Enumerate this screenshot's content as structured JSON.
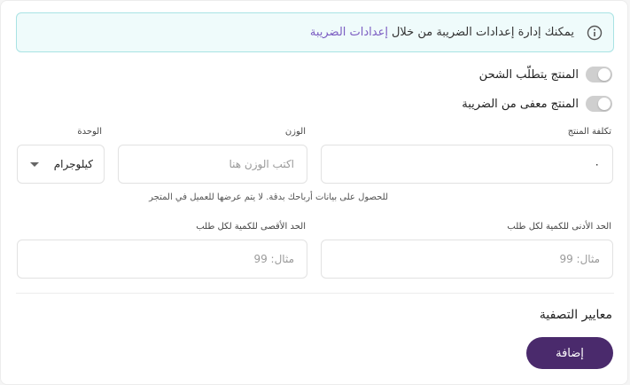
{
  "notice": {
    "text": "يمكنك إدارة إعدادات الضريبة من خلال",
    "link": "إعدادات الضريبة"
  },
  "toggles": {
    "shipping_label": "المنتج يتطلّب الشحن",
    "tax_exempt_label": "المنتج معفى من الضريبة"
  },
  "cost": {
    "label": "تكلفة المنتج",
    "value": "٠",
    "hint": "للحصول على بيانات أرباحك بدقة. لا يتم عرضها للعميل في المتجر"
  },
  "weight": {
    "label": "الوزن",
    "placeholder": "اكتب الوزن هنا"
  },
  "unit": {
    "label": "الوحدة",
    "value": "كيلوجرام"
  },
  "min_qty": {
    "label": "الحد الأدنى للكمية لكل طلب",
    "placeholder": "مثال: 99"
  },
  "max_qty": {
    "label": "الحد الأقصى للكمية لكل طلب",
    "placeholder": "مثال: 99"
  },
  "filters": {
    "title": "معايير التصفية",
    "add_label": "إضافة"
  },
  "colors": {
    "accent": "#4a2a6c",
    "link": "#7b5cc2",
    "notice_bg": "#effbfb",
    "notice_border": "#a9e3e4"
  }
}
